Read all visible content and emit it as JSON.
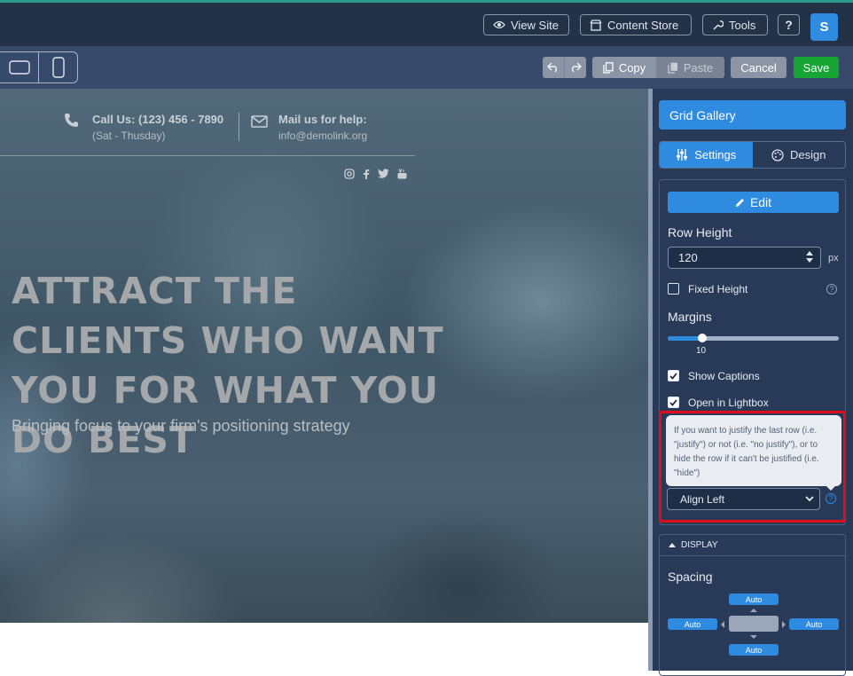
{
  "topbar": {
    "view_site": "View Site",
    "content_store": "Content Store",
    "tools": "Tools",
    "help": "?",
    "user_initial": "S"
  },
  "toolbar": {
    "copy": "Copy",
    "paste": "Paste",
    "cancel": "Cancel",
    "save": "Save"
  },
  "canvas": {
    "call_label": "Call Us: (123) 456 - 7890",
    "call_hours": "(Sat - Thusday)",
    "mail_label": "Mail us for help:",
    "mail_address": "info@demolink.org",
    "hero_title": "ATTRACT THE CLIENTS WHO WANT YOU FOR WHAT YOU DO BEST",
    "hero_subtitle": "Bringing focus to your firm's positioning strategy",
    "social_icons": [
      "instagram-icon",
      "facebook-icon",
      "twitter-icon",
      "youtube-icon"
    ]
  },
  "panel": {
    "title": "Grid Gallery",
    "tabs": [
      {
        "label": "Settings",
        "active": true
      },
      {
        "label": "Design",
        "active": false
      }
    ],
    "edit_label": "Edit",
    "row_height": {
      "label": "Row Height",
      "value": "120",
      "unit": "px"
    },
    "fixed_height": {
      "label": "Fixed Height",
      "checked": false
    },
    "margins": {
      "label": "Margins",
      "value": "10",
      "fraction": 0.2
    },
    "show_captions": {
      "label": "Show Captions",
      "checked": true
    },
    "open_lightbox": {
      "label": "Open in Lightbox",
      "checked": true
    },
    "tooltip_text": "If you want to justify the last row (i.e. \"justify\") or not (i.e. \"no justify\"), or to hide the row if it can't be justified (i.e. \"hide\")",
    "last_row": {
      "selected": "Align Left"
    },
    "display": {
      "header": "DISPLAY",
      "spacing_label": "Spacing",
      "top": "Auto",
      "left": "Auto",
      "right": "Auto",
      "bottom": "Auto"
    }
  },
  "colors": {
    "accent": "#2f8be0",
    "save": "#17a534",
    "highlight": "#e00e1a",
    "panel_bg": "#283a58",
    "topbar_bg": "#243248"
  }
}
